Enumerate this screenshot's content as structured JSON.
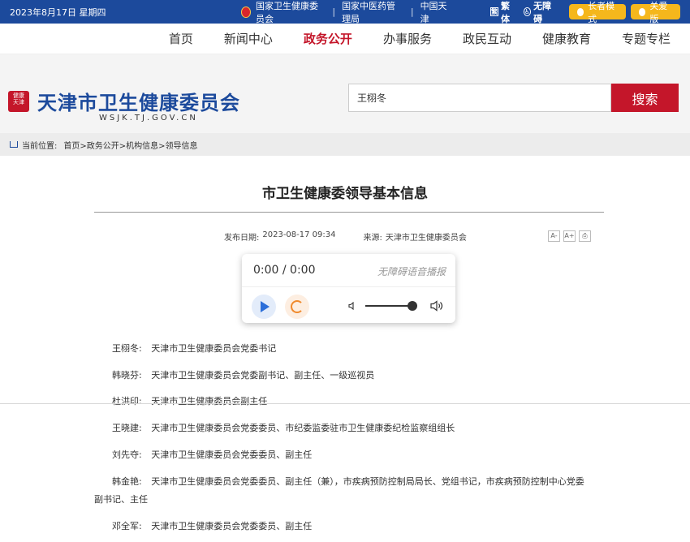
{
  "topbar": {
    "date": "2023年8月17日 星期四",
    "links": [
      "国家卫生健康委员会",
      "国家中医药管理局",
      "中国天津"
    ],
    "separator": "|",
    "tools": [
      {
        "label": "繁体",
        "icon": "traditional-chinese-icon"
      },
      {
        "label": "无障碍",
        "icon": "accessibility-icon"
      }
    ],
    "elder_mode": "长者模式",
    "care_version": "关爱版"
  },
  "nav": {
    "items": [
      "首页",
      "新闻中心",
      "政务公开",
      "办事服务",
      "政民互动",
      "健康教育",
      "专题专栏"
    ],
    "active_index": 2
  },
  "header": {
    "site_name": "天津市卫生健康委员会",
    "domain": "WSJK.TJ.GOV.CN",
    "search_value": "王栩冬",
    "search_button": "搜索"
  },
  "breadcrumb": {
    "label": "当前位置:",
    "path": "首页>政务公开>机构信息>领导信息"
  },
  "article": {
    "title": "市卫生健康委领导基本信息",
    "date_label": "发布日期:",
    "date": "2023-08-17 09:34",
    "source_label": "来源:",
    "source": "天津市卫生健康委员会",
    "tools": [
      "A-",
      "A+",
      "print"
    ]
  },
  "player": {
    "time": "0:00 / 0:00",
    "caption": "无障碍语音播报",
    "volume_level": 0.9
  },
  "leaders": [
    {
      "name": "王栩冬:",
      "title": "天津市卫生健康委员会党委书记"
    },
    {
      "name": "韩晓芬:",
      "title": "天津市卫生健康委员会党委副书记、副主任、一级巡视员"
    },
    {
      "name": "杜洪印:",
      "title": "天津市卫生健康委员会副主任"
    },
    {
      "name": "王晓建:",
      "title": "天津市卫生健康委员会党委委员、市纪委监委驻市卫生健康委纪检监察组组长"
    },
    {
      "name": "刘先夺:",
      "title": "天津市卫生健康委员会党委委员、副主任"
    },
    {
      "name": "韩金艳:",
      "title": "天津市卫生健康委员会党委委员、副主任（兼），市疾病预防控制局局长、党组书记，市疾病预防控制中心党委",
      "title_cont": "副书记、主任"
    },
    {
      "name": "邓全军:",
      "title": "天津市卫生健康委员会党委委员、副主任"
    }
  ],
  "colors": {
    "brand_blue": "#1c4a9c",
    "accent_red": "#c4162a",
    "pill_yellow": "#f5b71c"
  }
}
